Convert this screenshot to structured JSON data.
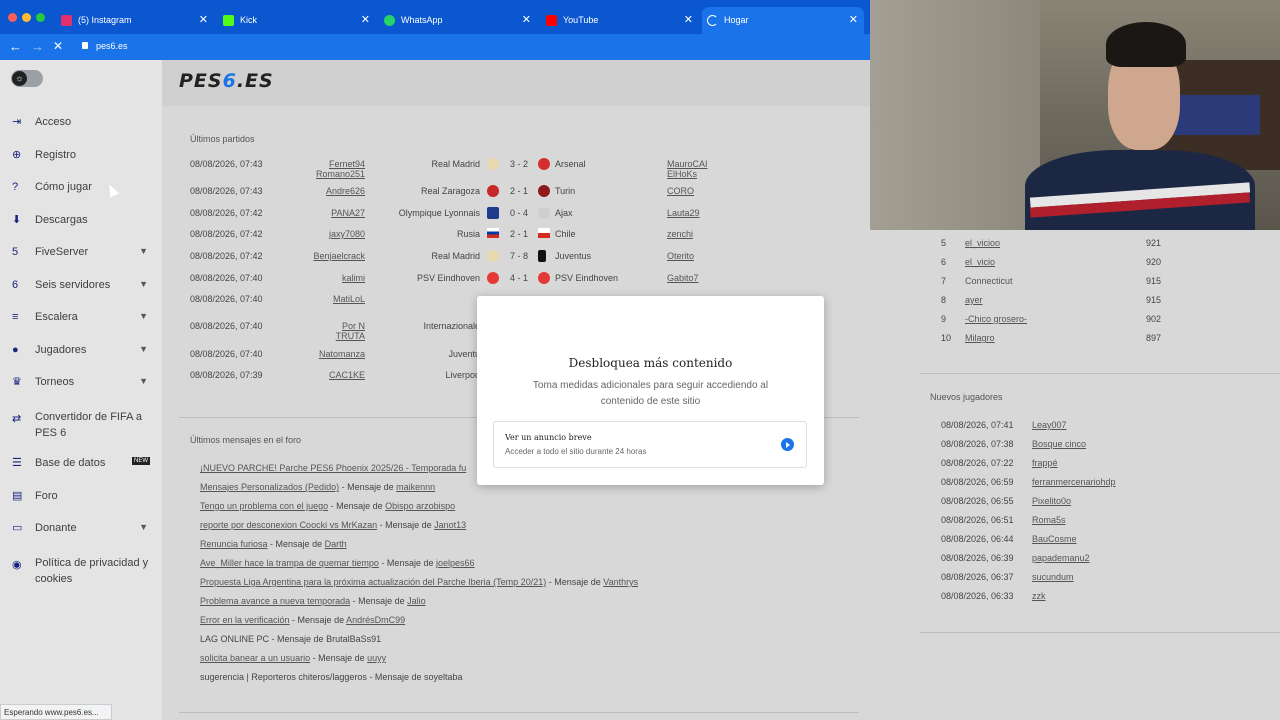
{
  "browser": {
    "tabs": [
      {
        "label": "(5) Instagram",
        "icon": "instagram-icon",
        "color": "#e1306c"
      },
      {
        "label": "Kick",
        "icon": "kick-icon",
        "color": "#53fc18"
      },
      {
        "label": "WhatsApp",
        "icon": "whatsapp-icon",
        "color": "#25d366"
      },
      {
        "label": "YouTube",
        "icon": "youtube-icon",
        "color": "#ff0000"
      },
      {
        "label": "Hogar",
        "icon": "loading-icon",
        "color": "#ffffff"
      }
    ],
    "url": "pes6.es",
    "status": "Esperando www.pes6.es..."
  },
  "site": {
    "logo_main": "PES",
    "logo_accent": "6",
    "logo_tail": ".ES"
  },
  "sidebar": {
    "items": [
      {
        "label": "Acceso",
        "icon": "login-icon",
        "chevron": false
      },
      {
        "label": "Registro",
        "icon": "register-icon",
        "chevron": false
      },
      {
        "label": "Cómo jugar",
        "icon": "help-icon",
        "chevron": false
      },
      {
        "label": "Descargas",
        "icon": "download-icon",
        "chevron": false
      },
      {
        "label": "FiveServer",
        "icon": "server-icon",
        "chevron": true
      },
      {
        "label": "Seis servidores",
        "icon": "servers-icon",
        "chevron": true
      },
      {
        "label": "Escalera",
        "icon": "ladder-icon",
        "chevron": true
      },
      {
        "label": "Jugadores",
        "icon": "players-icon",
        "chevron": true
      },
      {
        "label": "Torneos",
        "icon": "trophy-icon",
        "chevron": true
      },
      {
        "label": "Convertidor de FIFA a PES 6",
        "icon": "convert-icon",
        "chevron": false
      },
      {
        "label": "Base de datos",
        "icon": "database-icon",
        "chevron": false,
        "badge": "NEW"
      },
      {
        "label": "Foro",
        "icon": "forum-icon",
        "chevron": false
      },
      {
        "label": "Donante",
        "icon": "donate-icon",
        "chevron": true
      },
      {
        "label": "Política de privacidad y cookies",
        "icon": "privacy-icon",
        "chevron": false
      }
    ]
  },
  "matches": {
    "title": "Últimos partidos",
    "rows": [
      {
        "date": "08/08/2026, 07:43",
        "p1": "Fernet94",
        "p1b": "Romano251",
        "team1": "Real Madrid",
        "score": "3 - 2",
        "team2": "Arsenal",
        "p2": "MauroCAI",
        "p2b": "ElHoKs"
      },
      {
        "date": "08/08/2026, 07:43",
        "p1": "Andre626",
        "p1b": "",
        "team1": "Real Zaragoza",
        "score": "2 - 1",
        "team2": "Turin",
        "p2": "CORO",
        "p2b": ""
      },
      {
        "date": "08/08/2026, 07:42",
        "p1": "PANA27",
        "p1b": "",
        "team1": "Olympique Lyonnais",
        "score": "0 - 4",
        "team2": "Ajax",
        "p2": "Lauta29",
        "p2b": ""
      },
      {
        "date": "08/08/2026, 07:42",
        "p1": "jaxy7080",
        "p1b": "",
        "team1": "Rusia",
        "score": "2 - 1",
        "team2": "Chile",
        "p2": "zenchi",
        "p2b": ""
      },
      {
        "date": "08/08/2026, 07:42",
        "p1": "Benjaelcrack",
        "p1b": "",
        "team1": "Real Madrid",
        "score": "7 - 8",
        "team2": "Juventus",
        "p2": "Oterito",
        "p2b": ""
      },
      {
        "date": "08/08/2026, 07:40",
        "p1": "kalimi",
        "p1b": "",
        "team1": "PSV Eindhoven",
        "score": "4 - 1",
        "team2": "PSV Eindhoven",
        "p2": "Gabito7",
        "p2b": ""
      },
      {
        "date": "08/08/2026, 07:40",
        "p1": "MatiLoL",
        "p1b": "",
        "team1": "",
        "score": "",
        "team2": "",
        "p2": "",
        "p2b": ""
      },
      {
        "date": "08/08/2026, 07:40",
        "p1": "Por N",
        "p1b": "TRUTA",
        "team1": "Internazionale",
        "score": "",
        "team2": "",
        "p2": "",
        "p2b": ""
      },
      {
        "date": "08/08/2026, 07:40",
        "p1": "Natomanza",
        "p1b": "",
        "team1": "Juventu",
        "score": "",
        "team2": "",
        "p2": "",
        "p2b": ""
      },
      {
        "date": "08/08/2026, 07:39",
        "p1": "CAC1KE",
        "p1b": "",
        "team1": "Liverpoo",
        "score": "",
        "team2": "",
        "p2": "",
        "p2b": ""
      }
    ]
  },
  "forum": {
    "title": "Últimos mensajes en el foro",
    "rows": [
      {
        "topic": "¡NUEVO PARCHE! Parche PES6 Phoenix 2025/26 - Temporada fu",
        "sep": "",
        "user": ""
      },
      {
        "topic": "Mensajes Personalizados (Pedido)",
        "sep": " - Mensaje de ",
        "user": "maikennn"
      },
      {
        "topic": "Tengo un problema con el juego",
        "sep": " - Mensaje de ",
        "user": "Obispo arzobispo"
      },
      {
        "topic": "reporte por desconexion Coocki vs MrKazan",
        "sep": " - Mensaje de ",
        "user": "Janot13"
      },
      {
        "topic": "Renuncia furiosa",
        "sep": " - Mensaje de ",
        "user": "Darth"
      },
      {
        "topic": "Ave_Miller hace la trampa de quemar tiempo",
        "sep": " - Mensaje de ",
        "user": "joelpes66"
      },
      {
        "topic": "Propuesta Liga Argentina para la próxima actualización del Parche Iberia (Temp 20/21)",
        "sep": " - Mensaje de ",
        "user": "Vanthrys"
      },
      {
        "topic": "Problema avance a nueva temporada",
        "sep": " - Mensaje de ",
        "user": "Jalio"
      },
      {
        "topic": "Error en la verificación",
        "sep": " - Mensaje de ",
        "user": "AndrésDmC99"
      },
      {
        "topic": "LAG ONLINE PC",
        "sep": " - Mensaje de ",
        "user": "BrutalBaSs91"
      },
      {
        "topic": "solicita banear a un usuario",
        "sep": " - Mensaje de ",
        "user": "uuyy"
      },
      {
        "topic": "sugerencia | Reporteros chiteros/laggeros",
        "sep": " - Mensaje de ",
        "user": "soyeltaba"
      }
    ]
  },
  "ranking": {
    "rows": [
      {
        "pos": "5",
        "player": "el_vicioo",
        "points": "921"
      },
      {
        "pos": "6",
        "player": "el_vicio",
        "points": "920"
      },
      {
        "pos": "7",
        "player": "Connecticut",
        "points": "915"
      },
      {
        "pos": "8",
        "player": "ayer",
        "points": "915"
      },
      {
        "pos": "9",
        "player": "-Chico grosero-",
        "points": "902"
      },
      {
        "pos": "10",
        "player": "Milagro",
        "points": "897"
      }
    ]
  },
  "new_players": {
    "title": "Nuevos jugadores",
    "rows": [
      {
        "date": "08/08/2026, 07:41",
        "user": "Leay007"
      },
      {
        "date": "08/08/2026, 07:38",
        "user": "Bosque cinco"
      },
      {
        "date": "08/08/2026, 07:22",
        "user": "frappé"
      },
      {
        "date": "08/08/2026, 06:59",
        "user": "ferranmercenariohdp"
      },
      {
        "date": "08/08/2026, 06:55",
        "user": "Pixelito0o"
      },
      {
        "date": "08/08/2026, 06:51",
        "user": "Roma5s"
      },
      {
        "date": "08/08/2026, 06:44",
        "user": "BauCosme"
      },
      {
        "date": "08/08/2026, 06:39",
        "user": "papademanu2"
      },
      {
        "date": "08/08/2026, 06:37",
        "user": "sucundum"
      },
      {
        "date": "08/08/2026, 06:33",
        "user": "zzk"
      }
    ]
  },
  "modal": {
    "title": "Desbloquea más contenido",
    "subtitle": "Toma medidas adicionales para seguir accediendo al contenido de este sitio",
    "option_title": "Ver un anuncio breve",
    "option_sub": "Acceder a todo el sitio durante 24 horas"
  }
}
